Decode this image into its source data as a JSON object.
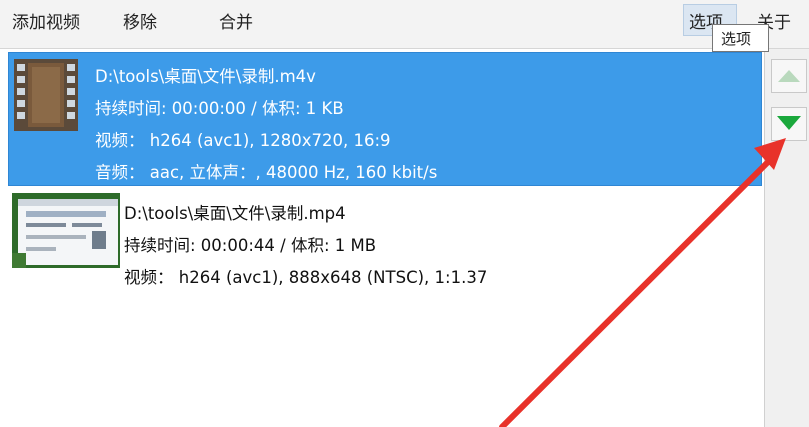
{
  "menubar": {
    "add_video": "添加视频",
    "remove": "移除",
    "merge": "合并",
    "options": "选项",
    "about": "关于"
  },
  "tooltip": {
    "text": "选项"
  },
  "files": [
    {
      "path": "D:\\tools\\桌面\\文件\\录制.m4v",
      "duration_size": "持续时间: 00:00:00 / 体积: 1 KB",
      "video": "视频： h264 (avc1), 1280x720, 16:9",
      "audio": "音频： aac, 立体声：, 48000 Hz, 160 kbit/s",
      "selected": true,
      "thumb_icon": "film-strip-icon"
    },
    {
      "path": "D:\\tools\\桌面\\文件\\录制.mp4",
      "duration_size": "持续时间: 00:00:44 / 体积: 1 MB",
      "video": "视频： h264 (avc1), 888x648 (NTSC), 1:1.37",
      "selected": false,
      "thumb_icon": "video-thumbnail"
    }
  ],
  "side": {
    "move_up_icon": "triangle-up-icon",
    "move_down_icon": "triangle-down-icon"
  },
  "colors": {
    "selection": "#3d9be9",
    "down_arrow": "#1aa83c",
    "annotation": "#e8322a"
  }
}
